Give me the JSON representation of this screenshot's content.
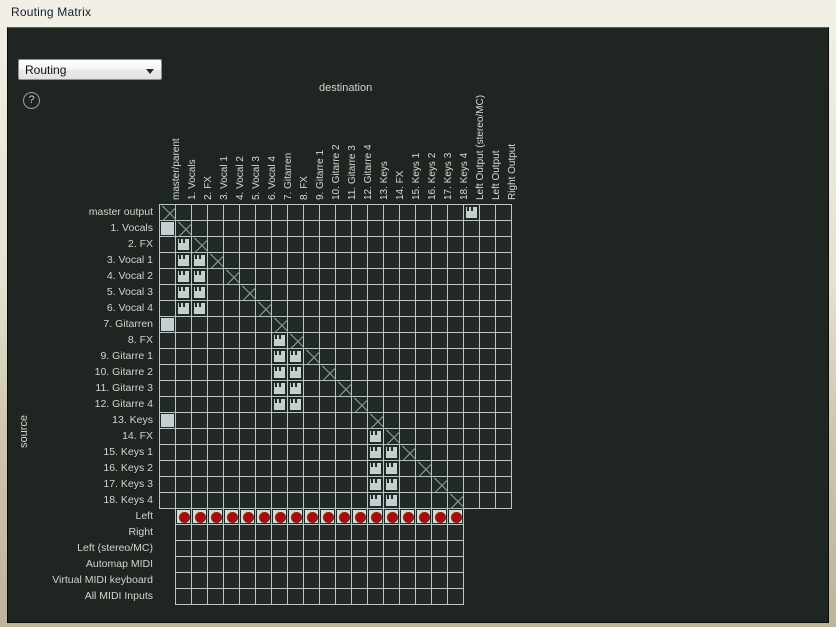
{
  "window": {
    "title": "Routing Matrix"
  },
  "toolbar": {
    "mode_select_value": "Routing",
    "mode_select_options": [
      "Routing"
    ],
    "help_label": "?"
  },
  "axes": {
    "destination_label": "destination",
    "source_label": "source"
  },
  "matrix": {
    "columns": [
      "master/parent",
      "1. Vocals",
      "2. FX",
      "3. Vocal 1",
      "4. Vocal 2",
      "5. Vocal 3",
      "6. Vocal 4",
      "7. Gitarren",
      "8. FX",
      "9. Gitarre 1",
      "10. Gitarre 2",
      "11. Gitarre 3",
      "12. Gitarre 4",
      "13. Keys",
      "14. FX",
      "15. Keys 1",
      "16. Keys 2",
      "17. Keys 3",
      "18. Keys 4",
      "Left Output (stereo/MC)",
      "Left Output",
      "Right Output"
    ],
    "rows": [
      "master output",
      "1. Vocals",
      "2. FX",
      "3. Vocal 1",
      "4. Vocal 2",
      "5. Vocal 3",
      "6. Vocal 4",
      "7. Gitarren",
      "8. FX",
      "9. Gitarre 1",
      "10. Gitarre 2",
      "11. Gitarre 3",
      "12. Gitarre 4",
      "13. Keys",
      "14. FX",
      "15. Keys 1",
      "16. Keys 2",
      "17. Keys 3",
      "18. Keys 4",
      "Left",
      "Right",
      "Left (stereo/MC)",
      "Automap MIDI",
      "Virtual MIDI keyboard",
      "All MIDI Inputs"
    ],
    "cells": [
      {
        "r": 0,
        "c": 0,
        "state": "x"
      },
      {
        "r": 0,
        "c": 19,
        "state": "strip"
      },
      {
        "r": 1,
        "c": 0,
        "state": "solid"
      },
      {
        "r": 1,
        "c": 1,
        "state": "x"
      },
      {
        "r": 2,
        "c": 1,
        "state": "strip"
      },
      {
        "r": 2,
        "c": 2,
        "state": "x"
      },
      {
        "r": 3,
        "c": 1,
        "state": "strip"
      },
      {
        "r": 3,
        "c": 2,
        "state": "strip"
      },
      {
        "r": 3,
        "c": 3,
        "state": "x"
      },
      {
        "r": 4,
        "c": 1,
        "state": "strip"
      },
      {
        "r": 4,
        "c": 2,
        "state": "strip"
      },
      {
        "r": 4,
        "c": 4,
        "state": "x"
      },
      {
        "r": 5,
        "c": 1,
        "state": "strip"
      },
      {
        "r": 5,
        "c": 2,
        "state": "strip"
      },
      {
        "r": 5,
        "c": 5,
        "state": "x"
      },
      {
        "r": 6,
        "c": 1,
        "state": "strip"
      },
      {
        "r": 6,
        "c": 2,
        "state": "strip"
      },
      {
        "r": 6,
        "c": 6,
        "state": "x"
      },
      {
        "r": 7,
        "c": 0,
        "state": "solid"
      },
      {
        "r": 7,
        "c": 7,
        "state": "x"
      },
      {
        "r": 8,
        "c": 7,
        "state": "strip"
      },
      {
        "r": 8,
        "c": 8,
        "state": "x"
      },
      {
        "r": 9,
        "c": 7,
        "state": "strip"
      },
      {
        "r": 9,
        "c": 8,
        "state": "strip"
      },
      {
        "r": 9,
        "c": 9,
        "state": "x"
      },
      {
        "r": 10,
        "c": 7,
        "state": "strip"
      },
      {
        "r": 10,
        "c": 8,
        "state": "strip"
      },
      {
        "r": 10,
        "c": 10,
        "state": "x"
      },
      {
        "r": 11,
        "c": 7,
        "state": "strip"
      },
      {
        "r": 11,
        "c": 8,
        "state": "strip"
      },
      {
        "r": 11,
        "c": 11,
        "state": "x"
      },
      {
        "r": 12,
        "c": 7,
        "state": "strip"
      },
      {
        "r": 12,
        "c": 8,
        "state": "strip"
      },
      {
        "r": 12,
        "c": 12,
        "state": "x"
      },
      {
        "r": 13,
        "c": 0,
        "state": "solid"
      },
      {
        "r": 13,
        "c": 13,
        "state": "x"
      },
      {
        "r": 14,
        "c": 13,
        "state": "strip"
      },
      {
        "r": 14,
        "c": 14,
        "state": "x"
      },
      {
        "r": 15,
        "c": 13,
        "state": "strip"
      },
      {
        "r": 15,
        "c": 14,
        "state": "strip"
      },
      {
        "r": 15,
        "c": 15,
        "state": "x"
      },
      {
        "r": 16,
        "c": 13,
        "state": "strip"
      },
      {
        "r": 16,
        "c": 14,
        "state": "strip"
      },
      {
        "r": 16,
        "c": 16,
        "state": "x"
      },
      {
        "r": 17,
        "c": 13,
        "state": "strip"
      },
      {
        "r": 17,
        "c": 14,
        "state": "strip"
      },
      {
        "r": 17,
        "c": 17,
        "state": "x"
      },
      {
        "r": 18,
        "c": 13,
        "state": "strip"
      },
      {
        "r": 18,
        "c": 14,
        "state": "strip"
      },
      {
        "r": 18,
        "c": 18,
        "state": "x"
      },
      {
        "r": 19,
        "c": 1,
        "state": "dot"
      },
      {
        "r": 19,
        "c": 2,
        "state": "dot"
      },
      {
        "r": 19,
        "c": 3,
        "state": "dot"
      },
      {
        "r": 19,
        "c": 4,
        "state": "dot"
      },
      {
        "r": 19,
        "c": 5,
        "state": "dot"
      },
      {
        "r": 19,
        "c": 6,
        "state": "dot"
      },
      {
        "r": 19,
        "c": 7,
        "state": "dot"
      },
      {
        "r": 19,
        "c": 8,
        "state": "dot"
      },
      {
        "r": 19,
        "c": 9,
        "state": "dot"
      },
      {
        "r": 19,
        "c": 10,
        "state": "dot"
      },
      {
        "r": 19,
        "c": 11,
        "state": "dot"
      },
      {
        "r": 19,
        "c": 12,
        "state": "dot"
      },
      {
        "r": 19,
        "c": 13,
        "state": "dot"
      },
      {
        "r": 19,
        "c": 14,
        "state": "dot"
      },
      {
        "r": 19,
        "c": 15,
        "state": "dot"
      },
      {
        "r": 19,
        "c": 16,
        "state": "dot"
      },
      {
        "r": 19,
        "c": 17,
        "state": "dot"
      },
      {
        "r": 19,
        "c": 18,
        "state": "dot"
      }
    ]
  },
  "colors": {
    "panel_bg": "#1f2622",
    "grid_line": "#b9c6c6",
    "cell_fill": "#c3d0d2",
    "dot_red": "#9b1111",
    "text": "#cfd6cf",
    "titlebar_text": "#12202c"
  }
}
